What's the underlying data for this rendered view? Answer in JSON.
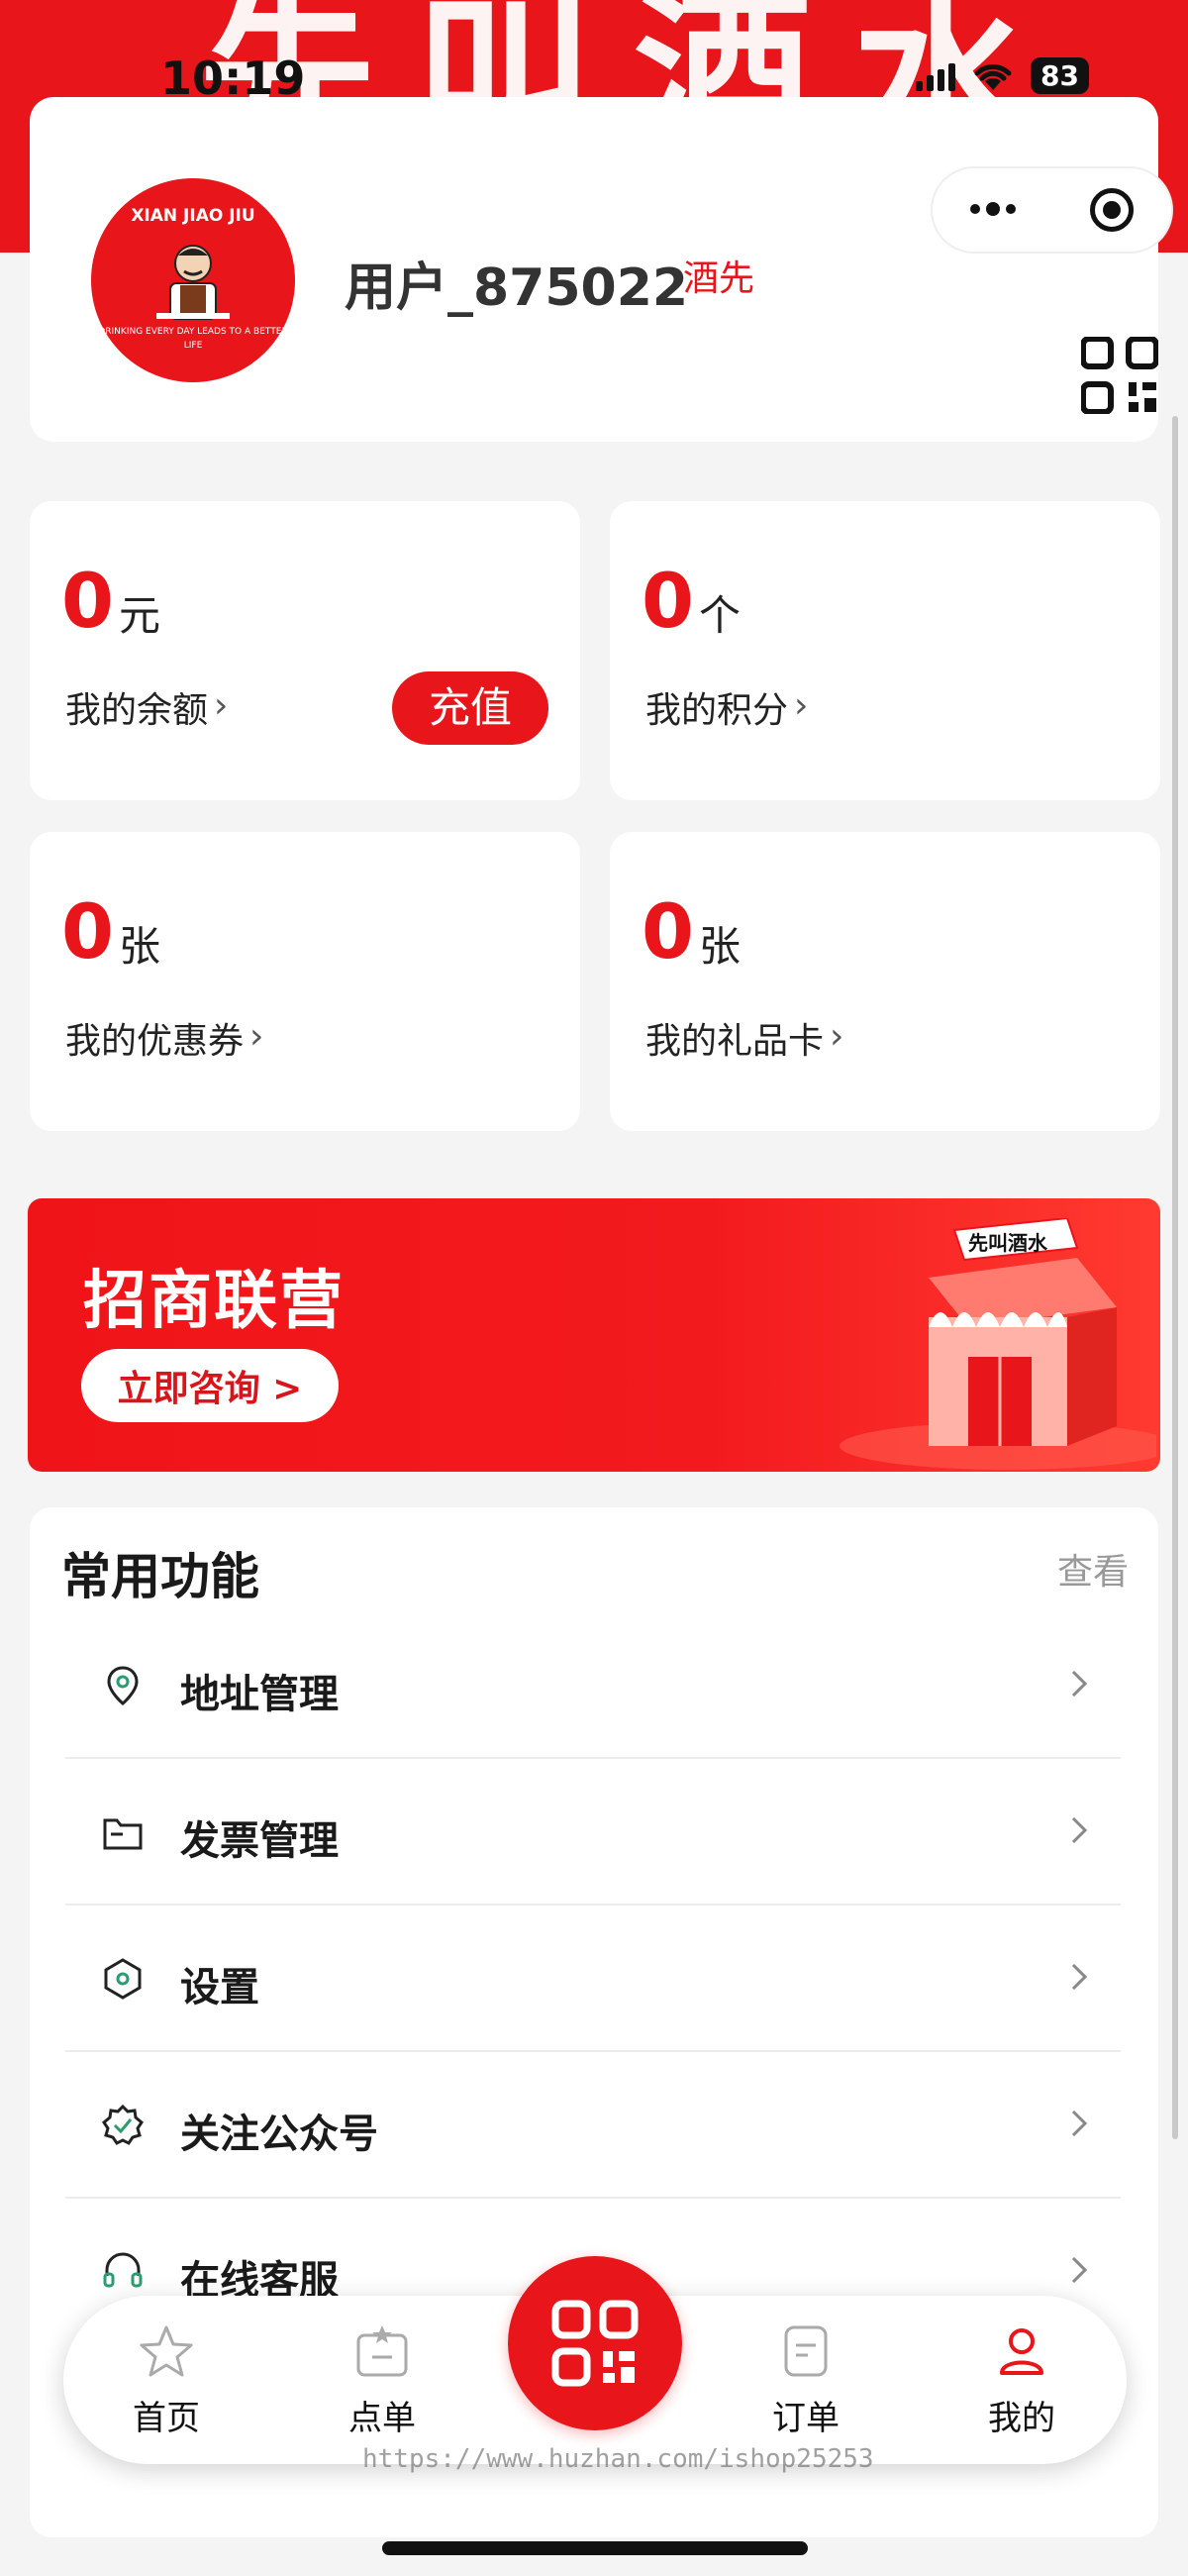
{
  "status_bar": {
    "time": "10:19",
    "battery": "83"
  },
  "hero": {
    "art_text": "先叫酒水"
  },
  "profile": {
    "avatar_top_text": "XIAN JIAO JIU",
    "avatar_bottom_text": "DRINKING EVERY DAY LEADS TO A BETTER LIFE",
    "username": "用户_875022",
    "tag": "酒先"
  },
  "stats": [
    {
      "value": "0",
      "unit": "元",
      "label": "我的余额"
    },
    {
      "value": "0",
      "unit": "个",
      "label": "我的积分"
    },
    {
      "value": "0",
      "unit": "张",
      "label": "我的优惠券"
    },
    {
      "value": "0",
      "unit": "张",
      "label": "我的礼品卡"
    }
  ],
  "recharge_label": "充值",
  "banner": {
    "title": "招商联营",
    "button": "立即咨询 >",
    "shop_sign": "先叫酒水"
  },
  "functions": {
    "title": "常用功能",
    "more": "查看",
    "items": [
      {
        "label": "地址管理",
        "icon": "location-icon"
      },
      {
        "label": "发票管理",
        "icon": "folder-icon"
      },
      {
        "label": "设置",
        "icon": "settings-hex-icon"
      },
      {
        "label": "关注公众号",
        "icon": "verified-badge-icon"
      },
      {
        "label": "在线客服",
        "icon": "headset-icon"
      }
    ]
  },
  "tabbar": {
    "items": [
      {
        "label": "首页",
        "icon": "star-icon"
      },
      {
        "label": "点单",
        "icon": "order-bag-icon"
      },
      {
        "label": "订单",
        "icon": "document-icon"
      },
      {
        "label": "我的",
        "icon": "user-icon"
      }
    ]
  },
  "watermark": "https://www.huzhan.com/ishop25253",
  "colors": {
    "accent": "#e8151b",
    "background": "#f4f4f4"
  }
}
